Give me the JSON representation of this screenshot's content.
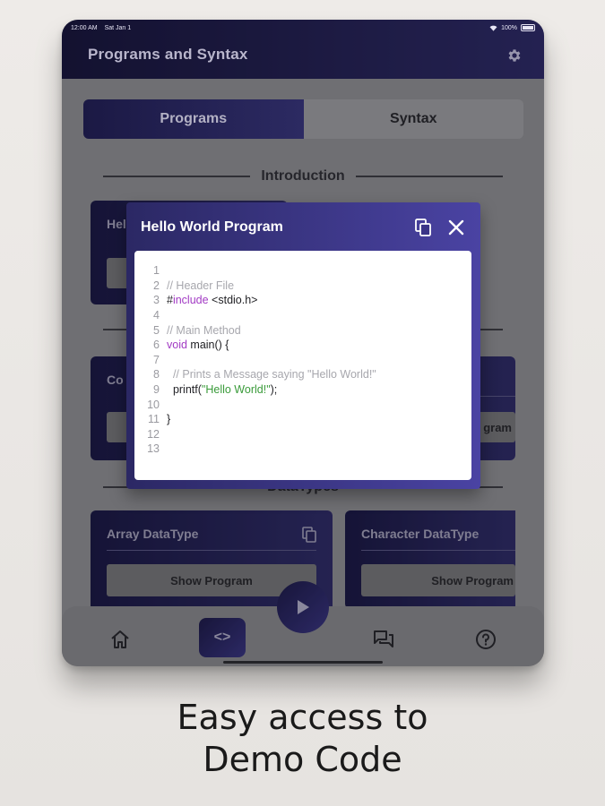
{
  "status_bar": {
    "time": "12:00 AM",
    "date": "Sat Jan 1",
    "battery": "100%"
  },
  "app_bar": {
    "title": "Programs and Syntax"
  },
  "tabs": [
    {
      "label": "Programs",
      "active": true
    },
    {
      "label": "Syntax",
      "active": false
    }
  ],
  "sections": {
    "introduction": "Introduction",
    "datatypes": "DataTypes"
  },
  "cards": {
    "intro_left": {
      "title": "Hel"
    },
    "second_left": {
      "title": "Co"
    },
    "second_right": {
      "button": "gram"
    },
    "array": {
      "title": "Array DataType",
      "button": "Show Program"
    },
    "character": {
      "title": "Character DataType",
      "button": "Show Program"
    }
  },
  "dialog": {
    "title": "Hello World Program",
    "code_lines": [
      {
        "num": "1",
        "tokens": []
      },
      {
        "num": "2",
        "tokens": [
          {
            "t": "comment",
            "v": "// Header File"
          }
        ]
      },
      {
        "num": "3",
        "tokens": [
          {
            "t": "text",
            "v": "#"
          },
          {
            "t": "keyword",
            "v": "include"
          },
          {
            "t": "text",
            "v": " <stdio.h>"
          }
        ]
      },
      {
        "num": "4",
        "tokens": []
      },
      {
        "num": "5",
        "tokens": [
          {
            "t": "comment",
            "v": "// Main Method"
          }
        ]
      },
      {
        "num": "6",
        "tokens": [
          {
            "t": "keyword",
            "v": "void"
          },
          {
            "t": "text",
            "v": " main() {"
          }
        ]
      },
      {
        "num": "7",
        "tokens": []
      },
      {
        "num": "8",
        "tokens": [
          {
            "t": "comment",
            "v": "  // Prints a Message saying \"Hello World!\""
          }
        ]
      },
      {
        "num": "9",
        "tokens": [
          {
            "t": "text",
            "v": "  printf("
          },
          {
            "t": "string",
            "v": "\"Hello World!\""
          },
          {
            "t": "text",
            "v": ");"
          }
        ]
      },
      {
        "num": "10",
        "tokens": []
      },
      {
        "num": "11",
        "tokens": [
          {
            "t": "text",
            "v": "}"
          }
        ]
      },
      {
        "num": "12",
        "tokens": []
      },
      {
        "num": "13",
        "tokens": []
      }
    ]
  },
  "bottom_nav": {
    "code_label": "<>"
  },
  "caption": {
    "line1": "Easy access to",
    "line2": "Demo Code"
  },
  "colors": {
    "accent_dark": "#1f1c4d",
    "accent_light": "#4a43a3",
    "keyword": "#a23bc4",
    "string": "#3a9b3a",
    "comment": "#a7a7ad"
  }
}
